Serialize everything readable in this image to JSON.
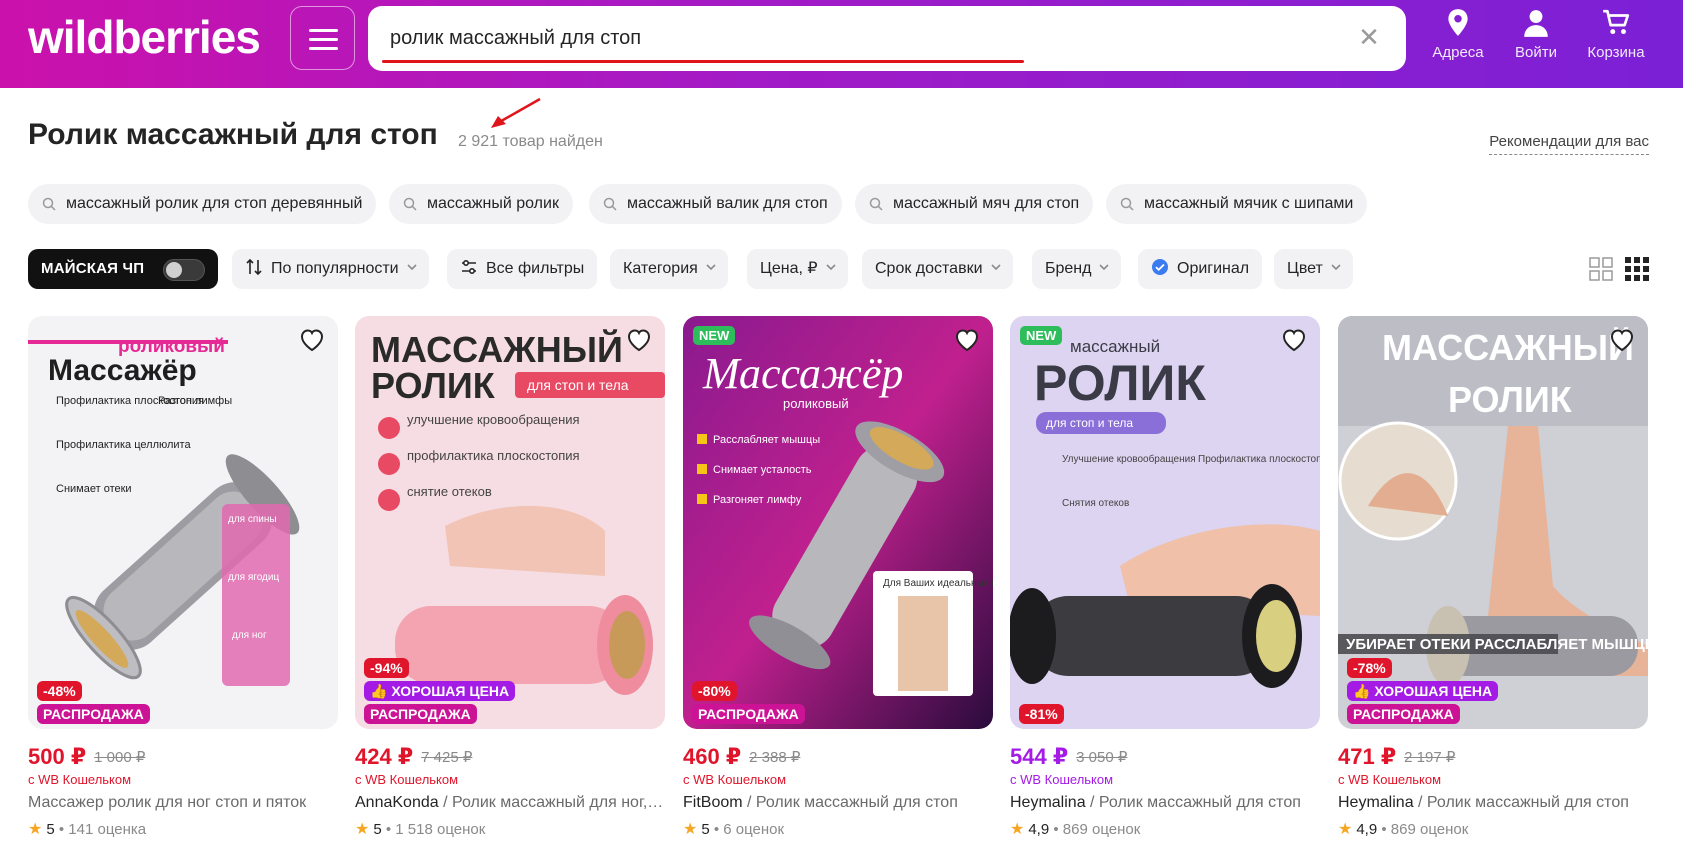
{
  "header": {
    "logo": "wildberries",
    "search_value": "ролик массажный для стоп",
    "nav": [
      {
        "label": "Адреса",
        "icon": "location-pin-icon"
      },
      {
        "label": "Войти",
        "icon": "user-icon"
      },
      {
        "label": "Корзина",
        "icon": "cart-icon"
      }
    ]
  },
  "page": {
    "title": "Ролик массажный для стоп",
    "count": "2 921 товар найден",
    "recommendations": "Рекомендации для вас"
  },
  "suggestions": [
    "массажный ролик для стоп деревянный",
    "массажный ролик",
    "массажный валик для стоп",
    "массажный мяч для стоп",
    "массажный мячик с шипами"
  ],
  "filters": {
    "promo": "МАЙСКАЯ ЧП",
    "sort": "По популярности",
    "all_filters": "Все фильтры",
    "category": "Категория",
    "price": "Цена, ₽",
    "delivery": "Срок доставки",
    "brand": "Бренд",
    "original": "Оригинал",
    "color": "Цвет"
  },
  "products": [
    {
      "price": "500 ₽",
      "old_price": "1 000 ₽",
      "wallet": "с WB Кошельком",
      "brand": "",
      "name": "Массажер ролик для ног стоп и пяток",
      "rating": "5",
      "reviews": "141 оценка",
      "discount": "-48%",
      "labels": [
        "РАСПРОДАЖА"
      ],
      "new": false,
      "image_text": {
        "line1": "роликовый",
        "line2": "Массажёр",
        "bullets": [
          "Профилактика плоскостопия",
          "Профилактика целлюлита",
          "Снимает отеки"
        ],
        "side": "Разгон лимфы",
        "tags": [
          "для спины",
          "для ягодиц",
          "для ног"
        ]
      }
    },
    {
      "price": "424 ₽",
      "old_price": "7 425 ₽",
      "wallet": "с WB Кошельком",
      "brand": "AnnaKonda",
      "name": " / Ролик массажный для ног, …",
      "rating": "5",
      "reviews": "1 518 оценок",
      "discount": "-94%",
      "labels": [
        "ХОРОШАЯ ЦЕНА",
        "РАСПРОДАЖА"
      ],
      "new": false,
      "image_text": {
        "line1": "МАССАЖНЫЙ",
        "line2": "РОЛИК",
        "tag": "для стоп и тела",
        "bullets": [
          "улучшение кровообращения",
          "профилактика плоскостопия",
          "снятие отеков"
        ]
      }
    },
    {
      "price": "460 ₽",
      "old_price": "2 388 ₽",
      "wallet": "с WB Кошельком",
      "brand": "FitBoom",
      "name": " / Ролик массажный для стоп",
      "rating": "5",
      "reviews": "6 оценок",
      "discount": "-80%",
      "labels": [
        "РАСПРОДАЖА"
      ],
      "new": true,
      "new_label": "NEW",
      "image_text": {
        "line1": "Массажёр",
        "line2": "роликовый",
        "bullets": [
          "Расслабляет мышцы",
          "Снимает усталость",
          "Разгоняет лимфу"
        ],
        "tag": "Для Ваших идеальных ног"
      }
    },
    {
      "price": "544 ₽",
      "old_price": "3 050 ₽",
      "wallet": "с WB Кошельком",
      "brand": "Heymalina",
      "name": " / Ролик массажный для стоп",
      "rating": "4,9",
      "reviews": "869 оценок",
      "discount": "-81%",
      "labels": [],
      "new": true,
      "new_label": "NEW",
      "image_text": {
        "line1": "массажный",
        "line2": "РОЛИК",
        "tag": "для стоп и тела",
        "bullets": [
          "Улучшение кровообращения",
          "Профилактика плоскостопия",
          "Снятия отеков"
        ]
      }
    },
    {
      "price": "471 ₽",
      "old_price": "2 197 ₽",
      "wallet": "с WB Кошельком",
      "brand": "Heymalina",
      "name": " / Ролик массажный для стоп",
      "rating": "4,9",
      "reviews": "869 оценок",
      "discount": "-78%",
      "labels": [
        "ХОРОШАЯ ЦЕНА",
        "РАСПРОДАЖА"
      ],
      "new": false,
      "image_text": {
        "line1": "МАССАЖНЫЙ",
        "line2": "РОЛИК",
        "bottom": "УБИРАЕТ ОТЕКИ РАССЛАБЛЯЕТ МЫШЦЫ РАЗГОНЯЕТ ЛИМФУ"
      }
    }
  ],
  "colors": {
    "brand_pink": "#cb11ab",
    "brand_purple": "#7b20d6",
    "price_red": "#e0152b",
    "price_purple": "#a51be6"
  }
}
